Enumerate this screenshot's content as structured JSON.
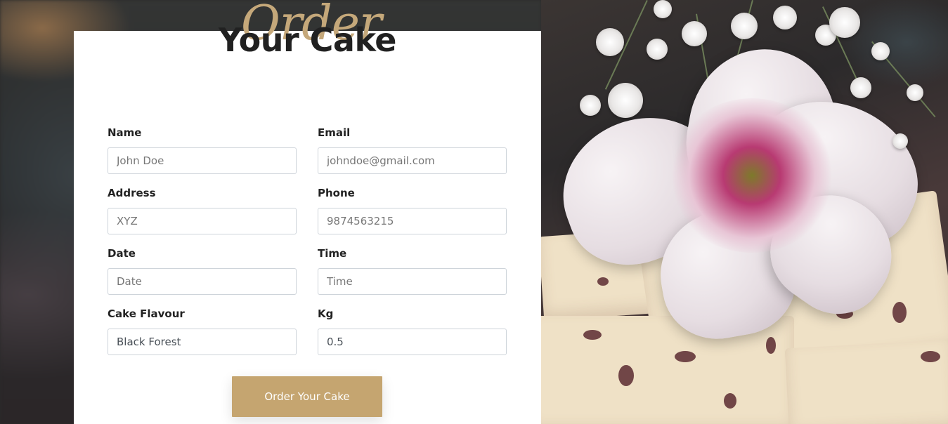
{
  "header": {
    "script_word": "Order",
    "title": "Your Cake"
  },
  "form": {
    "fields": [
      {
        "label": "Name",
        "placeholder": "John Doe",
        "value": ""
      },
      {
        "label": "Email",
        "placeholder": "johndoe@gmail.com",
        "value": ""
      },
      {
        "label": "Address",
        "placeholder": "XYZ",
        "value": ""
      },
      {
        "label": "Phone",
        "placeholder": "9874563215",
        "value": ""
      },
      {
        "label": "Date",
        "placeholder": "Date",
        "value": ""
      },
      {
        "label": "Time",
        "placeholder": "Time",
        "value": ""
      },
      {
        "label": "Cake Flavour",
        "placeholder": "",
        "value": "Black Forest"
      },
      {
        "label": "Kg",
        "placeholder": "",
        "value": "0.5"
      }
    ],
    "submit_label": "Order Your Cake"
  },
  "colors": {
    "accent": "#c5a570",
    "script": "#c5a87a",
    "title": "#212121"
  }
}
